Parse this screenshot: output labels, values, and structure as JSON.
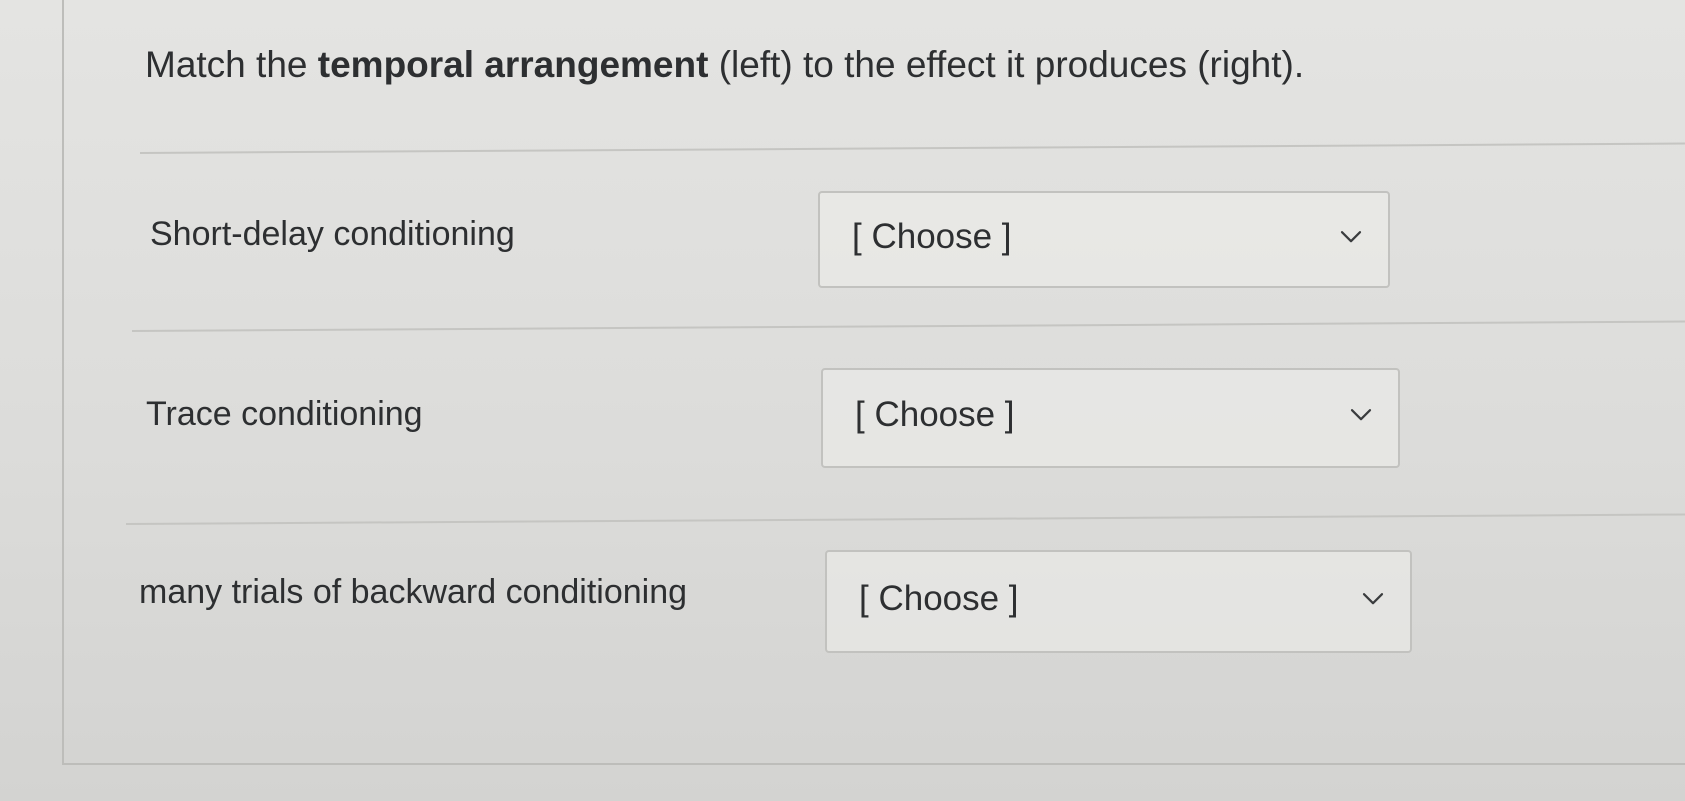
{
  "question": {
    "prompt_pre": "Match the ",
    "prompt_bold": "temporal arrangement",
    "prompt_post": " (left) to the effect it produces (right)."
  },
  "rows": [
    {
      "label": "Short-delay conditioning",
      "selected": "[ Choose ]",
      "icon": "chevron-down-icon"
    },
    {
      "label": "Trace conditioning",
      "selected": "[ Choose ]",
      "icon": "chevron-down-icon"
    },
    {
      "label": "many trials of backward conditioning",
      "selected": "[ Choose ]",
      "icon": "chevron-down-icon"
    }
  ],
  "colors": {
    "text": "#2d2f31",
    "border": "#c2c2bf",
    "background": "#dcdcda"
  }
}
